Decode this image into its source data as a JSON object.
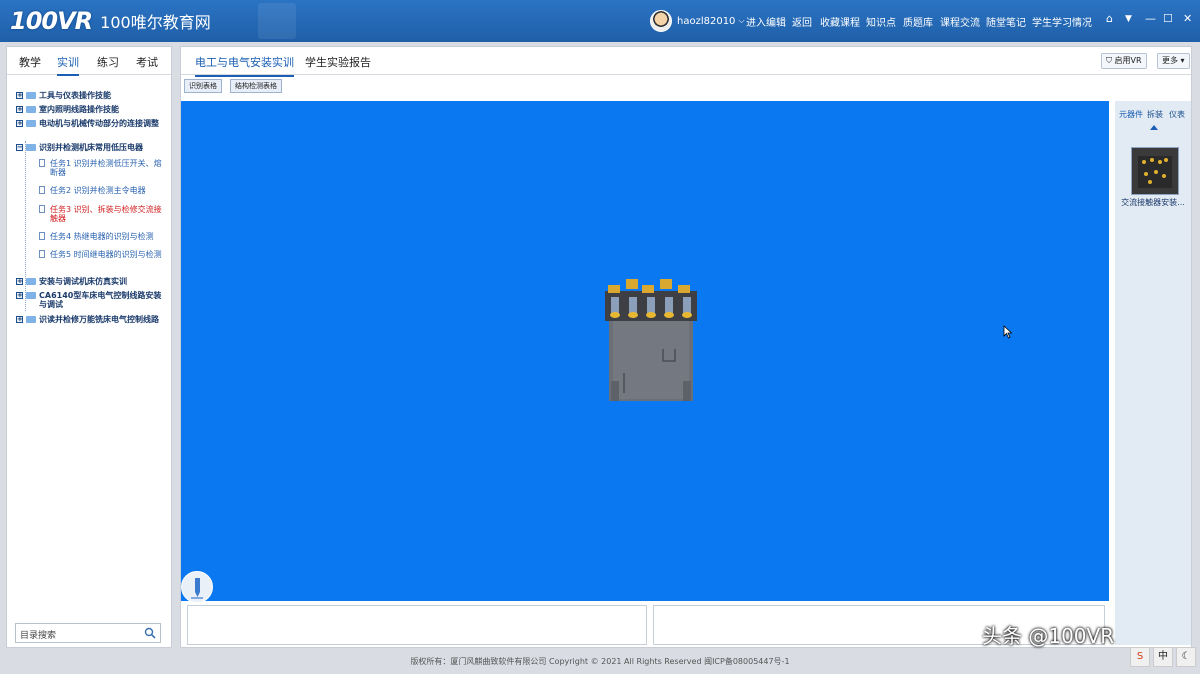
{
  "brand": {
    "logo": "100VR",
    "title": "100唯尔教育网"
  },
  "header": {
    "username": "haozl82010",
    "nav": [
      "进入编辑",
      "返回",
      "收藏课程",
      "知识点",
      "质题库",
      "课程交流",
      "随堂笔记",
      "学生学习情况"
    ],
    "icons": [
      "home-icon",
      "dropdown-icon",
      "minimize-icon",
      "maximize-icon",
      "close-icon"
    ]
  },
  "left": {
    "tabs": [
      "教学",
      "实训",
      "练习",
      "考试"
    ],
    "active_tab": "实训",
    "tree": [
      {
        "label": "工具与仪表操作技能"
      },
      {
        "label": "室内照明线路操作技能"
      },
      {
        "label": "电动机与机械传动部分的连接调整"
      },
      {
        "label": "识别并检测机床常用低压电器"
      },
      {
        "label": "安装与调试机床仿真实训"
      },
      {
        "label": "CA6140型车床电气控制线路安装与调试"
      },
      {
        "label": "识读并检修万能铣床电气控制线路"
      }
    ],
    "children": [
      {
        "label": "任务1 识别并检测低压开关、熔断器"
      },
      {
        "label": "任务2 识别并检测主令电器"
      },
      {
        "label": "任务3 识别、拆装与检修交流接触器"
      },
      {
        "label": "任务4 热继电器的识别与检测"
      },
      {
        "label": "任务5 时间继电器的识别与检测"
      }
    ],
    "search_placeholder": "目录搜索"
  },
  "main": {
    "tabs": [
      "电工与电气安装实训",
      "学生实验报告"
    ],
    "active_tab": "电工与电气安装实训",
    "buttons": {
      "vr": "启用VR",
      "more": "更多"
    },
    "subbuttons": [
      "识别表格",
      "结构检测表格"
    ],
    "right_tabs": [
      "元器件",
      "拆装",
      "仪表"
    ],
    "component_caption": "交流接触器安装..."
  },
  "footer": "版权所有：厦门风麒曲致软件有限公司 Copyright © 2021 All Rights Reserved 闽ICP备08005447号-1",
  "watermark": "头条 @100VR",
  "colors": {
    "topbar": "#1f5fa8",
    "viewport": "#0a78f0",
    "accent": "#1a5fb4",
    "active_task": "#d22020"
  }
}
